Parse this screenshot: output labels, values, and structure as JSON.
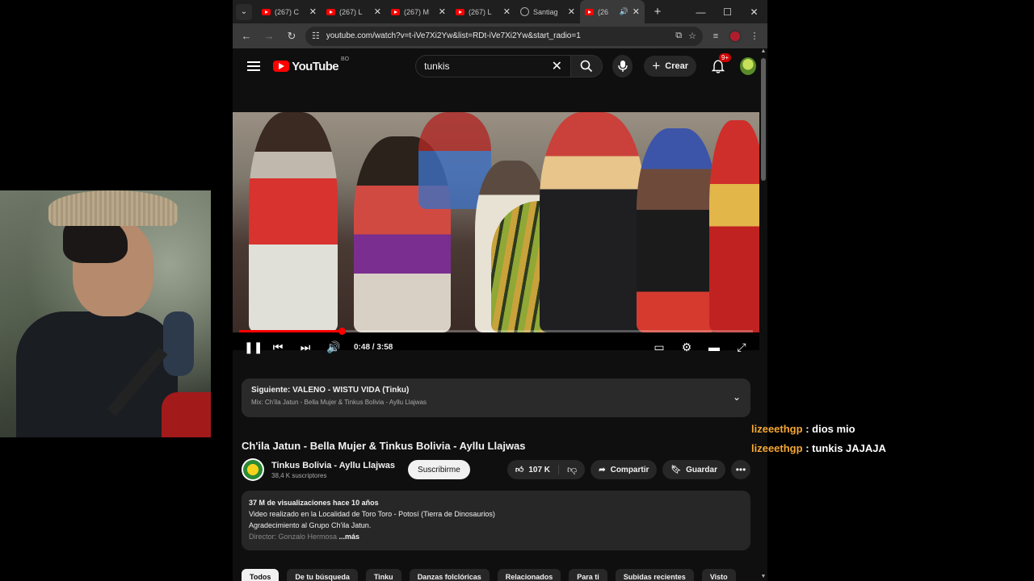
{
  "browser": {
    "tabs": [
      {
        "title": "(267) C",
        "type": "youtube"
      },
      {
        "title": "(267) L",
        "type": "youtube"
      },
      {
        "title": "(267) M",
        "type": "youtube"
      },
      {
        "title": "(267) L",
        "type": "youtube"
      },
      {
        "title": "Santiag",
        "type": "web"
      },
      {
        "title": "(26",
        "type": "youtube",
        "active": true,
        "audio": true
      }
    ],
    "url": "youtube.com/watch?v=t-iVe7Xi2Yw&list=RDt-iVe7Xi2Yw&start_radio=1"
  },
  "youtube": {
    "logo_text": "YouTube",
    "country_code": "BO",
    "search_query": "tunkis",
    "create_label": "Crear",
    "notifications_badge": "9+",
    "player": {
      "time": "0:48 / 3:58",
      "progress_fraction": 0.2
    },
    "up_next": {
      "label": "Siguiente: VALENO - WISTU VIDA (Tinku)",
      "mix": "Mix: Ch'ila Jatun - Bella Mujer & Tinkus Bolivia - Ayllu Llajwas"
    },
    "video": {
      "title": "Ch'ila Jatun - Bella Mujer & Tinkus Bolivia - Ayllu Llajwas",
      "channel": "Tinkus Bolivia - Ayllu Llajwas",
      "subscribers": "38,4 K suscriptores",
      "subscribe_label": "Suscribirme",
      "likes": "107 K",
      "share_label": "Compartir",
      "save_label": "Guardar"
    },
    "description": {
      "meta": "37 M de visualizaciones  hace 10 años",
      "line1": "Video realizado en la Localidad de Toro Toro - Potosí (Tierra de Dinosaurios)",
      "line2": "Agradecimiento al Grupo Ch'ila Jatun.",
      "line3": " Director: Gonzalo Hermosa",
      "more": " ...más"
    },
    "chips": [
      "Todos",
      "De tu búsqueda",
      "Tinku",
      "Danzas folclóricas",
      "Relacionados",
      "Para ti",
      "Subidas recientes",
      "Visto"
    ]
  },
  "chat": [
    {
      "user": "lizeeethgp",
      "message": "dios mio"
    },
    {
      "user": "lizeeethgp",
      "message": "tunkis JAJAJA"
    }
  ],
  "colors": {
    "accent": "#ff0000",
    "chat_user": "#f5a733",
    "background": "#0f0f0f"
  }
}
